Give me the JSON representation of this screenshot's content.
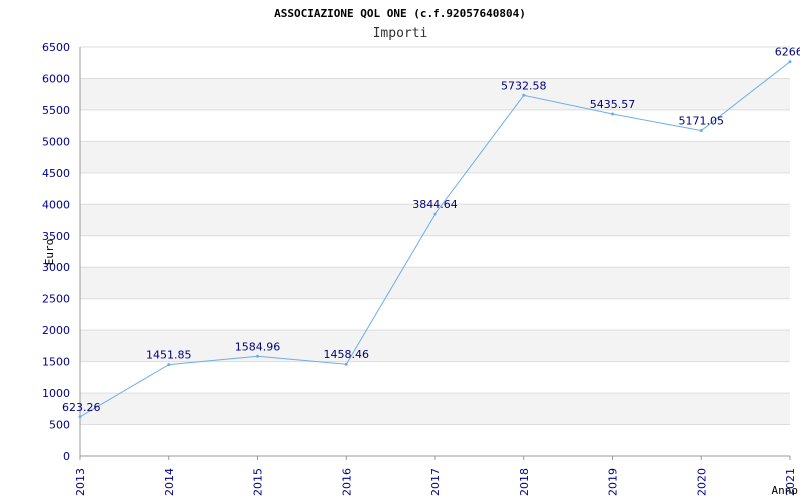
{
  "chart_data": {
    "type": "line",
    "title": "ASSOCIAZIONE QOL ONE (c.f.92057640804)",
    "subtitle": "Importi",
    "xlabel": "Anno",
    "ylabel": "Euro",
    "x": [
      "2013",
      "2014",
      "2015",
      "2016",
      "2017",
      "2018",
      "2019",
      "2020",
      "2021"
    ],
    "series": [
      {
        "values": [
          623.26,
          1451.85,
          1584.96,
          1458.46,
          3844.64,
          5732.58,
          5435.57,
          5171.05,
          6266.0
        ]
      }
    ],
    "data_labels": [
      "623.26",
      "1451.85",
      "1584.96",
      "1458.46",
      "3844.64",
      "5732.58",
      "5435.57",
      "5171.05",
      "6266.0"
    ],
    "yticks": [
      "0",
      "500",
      "1000",
      "1500",
      "2000",
      "2500",
      "3000",
      "3500",
      "4000",
      "4500",
      "5000",
      "5500",
      "6000",
      "6500"
    ],
    "ylim": [
      0,
      6500
    ],
    "grid": true,
    "colors": {
      "line": "#6aaee8",
      "tick_text": "#00008b",
      "data_label": "#000080",
      "band": "#f3f3f3",
      "grid": "#dddddd",
      "title": "#000000"
    }
  }
}
